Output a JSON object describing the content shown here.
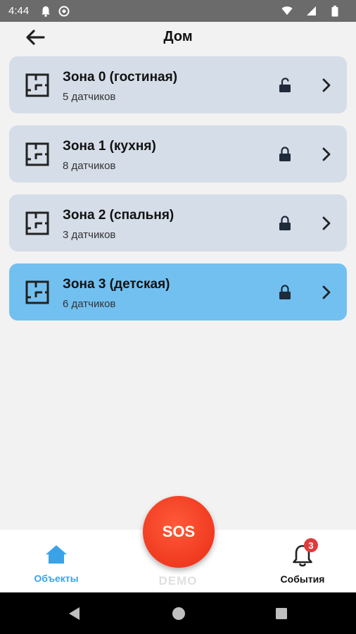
{
  "status_bar": {
    "time": "4:44",
    "icons": [
      "notification-bell-icon",
      "sync-icon",
      "wifi-icon",
      "signal-icon",
      "battery-icon"
    ]
  },
  "header": {
    "title": "Дом",
    "back_icon": "arrow-left-icon"
  },
  "zones": [
    {
      "name": "Зона 0 (гостиная)",
      "count": "5 датчиков",
      "locked": false,
      "active": false
    },
    {
      "name": "Зона 1 (кухня)",
      "count": "8 датчиков",
      "locked": true,
      "active": false
    },
    {
      "name": "Зона 2 (спальня)",
      "count": "3 датчиков",
      "locked": true,
      "active": false
    },
    {
      "name": "Зона 3 (детская)",
      "count": "6 датчиков",
      "locked": true,
      "active": true
    }
  ],
  "bottom_nav": {
    "objects_label": "Объекты",
    "events_label": "События",
    "events_badge": "3",
    "sos_label": "SOS",
    "demo_label": "DEMO"
  },
  "colors": {
    "zone_bg": "#d5dde8",
    "zone_active_bg": "#72c0f0",
    "accent": "#3aa3e8",
    "sos": "#f03a20",
    "badge": "#e03b3b"
  }
}
